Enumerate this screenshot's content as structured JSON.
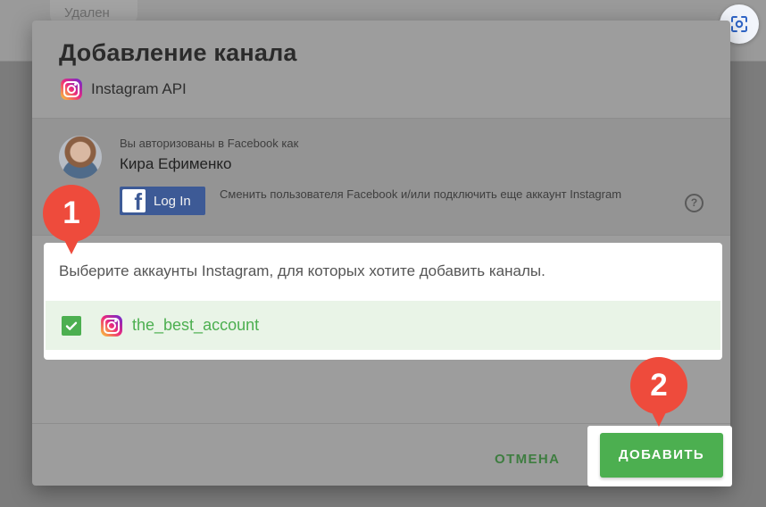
{
  "background": {
    "tab_label": "Удален"
  },
  "modal": {
    "title": "Добавление канала",
    "api_label": "Instagram API",
    "auth": {
      "caption": "Вы авторизованы в Facebook как",
      "user_name": "Кира Ефименко",
      "login_label": "Log In",
      "switch_text": "Сменить пользователя Facebook и/или подключить еще аккаунт Instagram"
    },
    "select_text": "Выберите аккаунты Instagram, для которых хотите добавить каналы.",
    "accounts": [
      {
        "name": "the_best_account",
        "checked": true
      }
    ],
    "cancel_label": "ОТМЕНА",
    "add_label": "ДОБАВИТЬ"
  },
  "markers": [
    "1",
    "2"
  ],
  "colors": {
    "accent": "#4caf50",
    "facebook": "#3d5a96",
    "marker": "#ee4b3c",
    "selected_row": "#e9f4e7"
  },
  "icons": [
    "screenshot-icon",
    "instagram-icon",
    "facebook-icon",
    "help-icon",
    "check-icon"
  ]
}
